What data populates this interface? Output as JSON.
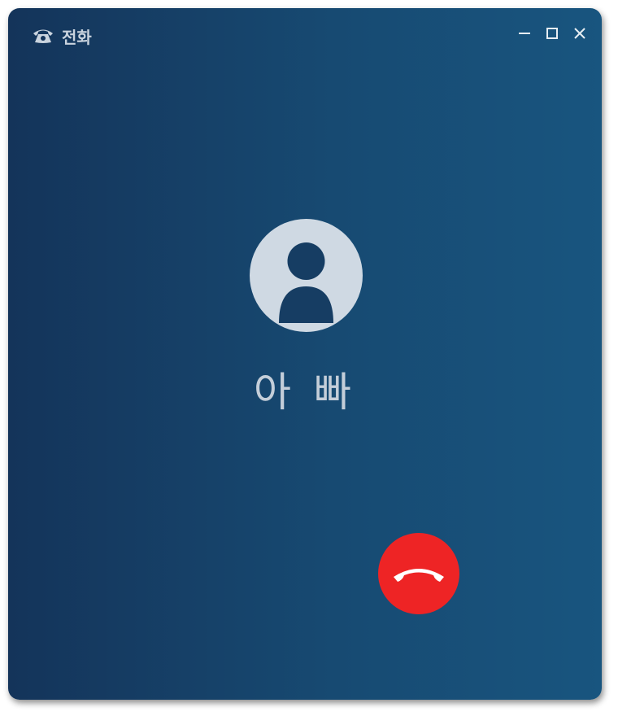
{
  "window": {
    "title": "전화",
    "icon": "phone-icon",
    "controls": [
      "minimize-icon",
      "maximize-icon",
      "close-icon"
    ]
  },
  "call": {
    "caller_name": "아 빠",
    "avatar": "person-icon",
    "hangup_icon": "phone-hangup-icon"
  },
  "colors": {
    "background_start": "#14345a",
    "background_end": "#18557f",
    "hangup": "#ee2425",
    "avatar_bg": "#cfd9e3"
  }
}
